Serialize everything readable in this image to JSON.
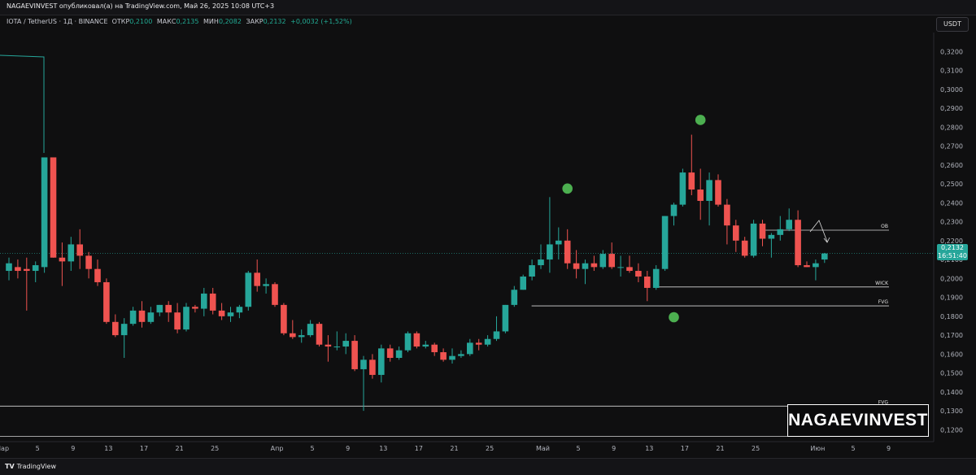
{
  "header": {
    "published": "NAGAEVINVEST опубликовал(а) на TradingView.com, Май 26, 2025 10:08 UTC+3"
  },
  "symbol": {
    "name": "IOTA / TetherUS · 1Д · BINANCE",
    "open_label": "ОТКР",
    "open": "0,2100",
    "high_label": "МАКС",
    "high": "0,2135",
    "low_label": "МИН",
    "low": "0,2082",
    "close_label": "ЗАКР",
    "close": "0,2132",
    "change": "+0,0032 (+1,52%)"
  },
  "currency_button": "USDT",
  "price_tag": {
    "price": "0,2132",
    "timer": "16:51:40"
  },
  "watermark": "NAGAEVINVEST",
  "footer": {
    "brand": "TradingView"
  },
  "colors": {
    "up": "#26a69a",
    "down": "#ef5350",
    "marker": "#4caf50",
    "background": "#0f0f10"
  },
  "chart_data": {
    "type": "candlestick",
    "ylim": [
      0.115,
      0.33
    ],
    "y_ticks": [
      0.12,
      0.13,
      0.14,
      0.15,
      0.16,
      0.17,
      0.18,
      0.19,
      0.2,
      0.21,
      0.22,
      0.23,
      0.24,
      0.25,
      0.26,
      0.27,
      0.28,
      0.29,
      0.3,
      0.31,
      0.32
    ],
    "y_tick_labels": [
      "0,1200",
      "0,1300",
      "0,1400",
      "0,1500",
      "0,1600",
      "0,1700",
      "0,1800",
      "0,1900",
      "0,2000",
      "0,2100",
      "0,2200",
      "0,2300",
      "0,2400",
      "0,2500",
      "0,2600",
      "0,2700",
      "0,2800",
      "0,2900",
      "0,3000",
      "0,3100",
      "0,3200"
    ],
    "x_labels": [
      "Мар",
      "5",
      "9",
      "13",
      "17",
      "21",
      "25",
      "Апр",
      "5",
      "9",
      "13",
      "17",
      "21",
      "25",
      "Май",
      "5",
      "9",
      "13",
      "17",
      "21",
      "25",
      "Июн",
      "5",
      "9"
    ],
    "x_label_days": [
      -1,
      3,
      7,
      11,
      15,
      19,
      23,
      30,
      34,
      38,
      42,
      46,
      50,
      54,
      60,
      64,
      68,
      72,
      76,
      80,
      84,
      91,
      95,
      99
    ],
    "first_day": "2025-02-26",
    "candles": [
      {
        "o": 0.204,
        "h": 0.211,
        "l": 0.199,
        "c": 0.208
      },
      {
        "o": 0.206,
        "h": 0.21,
        "l": 0.2,
        "c": 0.204
      },
      {
        "o": 0.205,
        "h": 0.211,
        "l": 0.183,
        "c": 0.204
      },
      {
        "o": 0.204,
        "h": 0.209,
        "l": 0.198,
        "c": 0.207
      },
      {
        "o": 0.206,
        "h": 0.264,
        "l": 0.203,
        "c": 0.264
      },
      {
        "o": 0.264,
        "h": 0.264,
        "l": 0.211,
        "c": 0.211
      },
      {
        "o": 0.211,
        "h": 0.219,
        "l": 0.196,
        "c": 0.209
      },
      {
        "o": 0.209,
        "h": 0.222,
        "l": 0.204,
        "c": 0.218
      },
      {
        "o": 0.218,
        "h": 0.226,
        "l": 0.205,
        "c": 0.212
      },
      {
        "o": 0.212,
        "h": 0.214,
        "l": 0.2,
        "c": 0.205
      },
      {
        "o": 0.205,
        "h": 0.21,
        "l": 0.196,
        "c": 0.198
      },
      {
        "o": 0.198,
        "h": 0.2,
        "l": 0.176,
        "c": 0.177
      },
      {
        "o": 0.177,
        "h": 0.181,
        "l": 0.169,
        "c": 0.17
      },
      {
        "o": 0.17,
        "h": 0.179,
        "l": 0.158,
        "c": 0.176
      },
      {
        "o": 0.176,
        "h": 0.185,
        "l": 0.175,
        "c": 0.183
      },
      {
        "o": 0.183,
        "h": 0.188,
        "l": 0.174,
        "c": 0.177
      },
      {
        "o": 0.177,
        "h": 0.185,
        "l": 0.176,
        "c": 0.182
      },
      {
        "o": 0.182,
        "h": 0.186,
        "l": 0.18,
        "c": 0.186
      },
      {
        "o": 0.186,
        "h": 0.188,
        "l": 0.177,
        "c": 0.182
      },
      {
        "o": 0.182,
        "h": 0.187,
        "l": 0.171,
        "c": 0.173
      },
      {
        "o": 0.173,
        "h": 0.187,
        "l": 0.172,
        "c": 0.185
      },
      {
        "o": 0.185,
        "h": 0.186,
        "l": 0.182,
        "c": 0.184
      },
      {
        "o": 0.184,
        "h": 0.195,
        "l": 0.18,
        "c": 0.192
      },
      {
        "o": 0.192,
        "h": 0.195,
        "l": 0.181,
        "c": 0.183
      },
      {
        "o": 0.183,
        "h": 0.187,
        "l": 0.178,
        "c": 0.18
      },
      {
        "o": 0.18,
        "h": 0.185,
        "l": 0.177,
        "c": 0.182
      },
      {
        "o": 0.182,
        "h": 0.186,
        "l": 0.179,
        "c": 0.185
      },
      {
        "o": 0.185,
        "h": 0.204,
        "l": 0.183,
        "c": 0.203
      },
      {
        "o": 0.203,
        "h": 0.21,
        "l": 0.193,
        "c": 0.196
      },
      {
        "o": 0.196,
        "h": 0.2,
        "l": 0.192,
        "c": 0.197
      },
      {
        "o": 0.197,
        "h": 0.198,
        "l": 0.185,
        "c": 0.186
      },
      {
        "o": 0.186,
        "h": 0.187,
        "l": 0.17,
        "c": 0.171
      },
      {
        "o": 0.171,
        "h": 0.178,
        "l": 0.168,
        "c": 0.169
      },
      {
        "o": 0.169,
        "h": 0.173,
        "l": 0.166,
        "c": 0.17
      },
      {
        "o": 0.17,
        "h": 0.178,
        "l": 0.169,
        "c": 0.176
      },
      {
        "o": 0.176,
        "h": 0.177,
        "l": 0.164,
        "c": 0.165
      },
      {
        "o": 0.165,
        "h": 0.17,
        "l": 0.156,
        "c": 0.164
      },
      {
        "o": 0.164,
        "h": 0.172,
        "l": 0.162,
        "c": 0.164
      },
      {
        "o": 0.164,
        "h": 0.171,
        "l": 0.16,
        "c": 0.167
      },
      {
        "o": 0.167,
        "h": 0.17,
        "l": 0.151,
        "c": 0.152
      },
      {
        "o": 0.152,
        "h": 0.159,
        "l": 0.13,
        "c": 0.157
      },
      {
        "o": 0.157,
        "h": 0.16,
        "l": 0.147,
        "c": 0.149
      },
      {
        "o": 0.149,
        "h": 0.165,
        "l": 0.145,
        "c": 0.163
      },
      {
        "o": 0.163,
        "h": 0.165,
        "l": 0.156,
        "c": 0.158
      },
      {
        "o": 0.158,
        "h": 0.164,
        "l": 0.157,
        "c": 0.162
      },
      {
        "o": 0.162,
        "h": 0.172,
        "l": 0.161,
        "c": 0.171
      },
      {
        "o": 0.171,
        "h": 0.172,
        "l": 0.163,
        "c": 0.164
      },
      {
        "o": 0.164,
        "h": 0.167,
        "l": 0.163,
        "c": 0.165
      },
      {
        "o": 0.165,
        "h": 0.166,
        "l": 0.159,
        "c": 0.161
      },
      {
        "o": 0.161,
        "h": 0.163,
        "l": 0.156,
        "c": 0.157
      },
      {
        "o": 0.157,
        "h": 0.163,
        "l": 0.155,
        "c": 0.159
      },
      {
        "o": 0.159,
        "h": 0.162,
        "l": 0.158,
        "c": 0.16
      },
      {
        "o": 0.16,
        "h": 0.168,
        "l": 0.159,
        "c": 0.166
      },
      {
        "o": 0.166,
        "h": 0.168,
        "l": 0.162,
        "c": 0.165
      },
      {
        "o": 0.165,
        "h": 0.17,
        "l": 0.164,
        "c": 0.168
      },
      {
        "o": 0.168,
        "h": 0.18,
        "l": 0.167,
        "c": 0.172
      },
      {
        "o": 0.172,
        "h": 0.186,
        "l": 0.171,
        "c": 0.186
      },
      {
        "o": 0.186,
        "h": 0.196,
        "l": 0.185,
        "c": 0.194
      },
      {
        "o": 0.194,
        "h": 0.202,
        "l": 0.194,
        "c": 0.201
      },
      {
        "o": 0.201,
        "h": 0.21,
        "l": 0.199,
        "c": 0.207
      },
      {
        "o": 0.207,
        "h": 0.218,
        "l": 0.205,
        "c": 0.21
      },
      {
        "o": 0.21,
        "h": 0.243,
        "l": 0.203,
        "c": 0.218
      },
      {
        "o": 0.218,
        "h": 0.227,
        "l": 0.21,
        "c": 0.22
      },
      {
        "o": 0.22,
        "h": 0.226,
        "l": 0.205,
        "c": 0.208
      },
      {
        "o": 0.208,
        "h": 0.215,
        "l": 0.2,
        "c": 0.205
      },
      {
        "o": 0.205,
        "h": 0.21,
        "l": 0.197,
        "c": 0.208
      },
      {
        "o": 0.208,
        "h": 0.212,
        "l": 0.204,
        "c": 0.206
      },
      {
        "o": 0.206,
        "h": 0.215,
        "l": 0.205,
        "c": 0.213
      },
      {
        "o": 0.213,
        "h": 0.219,
        "l": 0.205,
        "c": 0.206
      },
      {
        "o": 0.206,
        "h": 0.212,
        "l": 0.201,
        "c": 0.206
      },
      {
        "o": 0.206,
        "h": 0.212,
        "l": 0.203,
        "c": 0.204
      },
      {
        "o": 0.204,
        "h": 0.208,
        "l": 0.198,
        "c": 0.201
      },
      {
        "o": 0.201,
        "h": 0.204,
        "l": 0.188,
        "c": 0.195
      },
      {
        "o": 0.195,
        "h": 0.207,
        "l": 0.194,
        "c": 0.205
      },
      {
        "o": 0.205,
        "h": 0.233,
        "l": 0.204,
        "c": 0.233
      },
      {
        "o": 0.233,
        "h": 0.24,
        "l": 0.228,
        "c": 0.239
      },
      {
        "o": 0.239,
        "h": 0.258,
        "l": 0.238,
        "c": 0.256
      },
      {
        "o": 0.256,
        "h": 0.276,
        "l": 0.244,
        "c": 0.247
      },
      {
        "o": 0.247,
        "h": 0.258,
        "l": 0.231,
        "c": 0.241
      },
      {
        "o": 0.241,
        "h": 0.256,
        "l": 0.228,
        "c": 0.252
      },
      {
        "o": 0.252,
        "h": 0.255,
        "l": 0.238,
        "c": 0.239
      },
      {
        "o": 0.239,
        "h": 0.242,
        "l": 0.218,
        "c": 0.228
      },
      {
        "o": 0.228,
        "h": 0.231,
        "l": 0.214,
        "c": 0.22
      },
      {
        "o": 0.22,
        "h": 0.222,
        "l": 0.211,
        "c": 0.212
      },
      {
        "o": 0.212,
        "h": 0.231,
        "l": 0.211,
        "c": 0.229
      },
      {
        "o": 0.229,
        "h": 0.231,
        "l": 0.217,
        "c": 0.221
      },
      {
        "o": 0.221,
        "h": 0.224,
        "l": 0.211,
        "c": 0.223
      },
      {
        "o": 0.223,
        "h": 0.233,
        "l": 0.22,
        "c": 0.226
      },
      {
        "o": 0.226,
        "h": 0.237,
        "l": 0.225,
        "c": 0.231
      },
      {
        "o": 0.231,
        "h": 0.236,
        "l": 0.206,
        "c": 0.207
      },
      {
        "o": 0.207,
        "h": 0.209,
        "l": 0.206,
        "c": 0.206
      },
      {
        "o": 0.206,
        "h": 0.21,
        "l": 0.199,
        "c": 0.208
      },
      {
        "o": 0.21,
        "h": 0.2135,
        "l": 0.2082,
        "c": 0.2132
      }
    ],
    "annotations": [
      {
        "label": "OB",
        "y": 0.2255,
        "x_start_day": 85
      },
      {
        "label": "WICK",
        "y": 0.1955,
        "x_start_day": 73
      },
      {
        "label": "FVG",
        "y": 0.1855,
        "x_start_day": 59
      },
      {
        "label": "FVG",
        "y": 0.1325,
        "x_start_day": -6
      },
      {
        "label": "FVG",
        "y": 0.1165,
        "x_start_day": -6
      }
    ],
    "markers": [
      {
        "day": 63,
        "y": 0.2475
      },
      {
        "day": 75,
        "y": 0.1795
      },
      {
        "day": 78,
        "y": 0.2838
      }
    ],
    "current_price": 0.2132
  }
}
